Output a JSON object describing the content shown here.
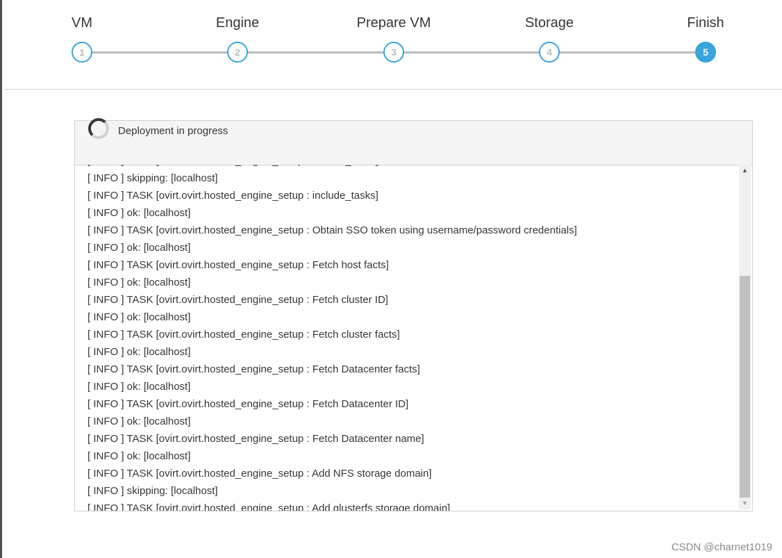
{
  "wizard": {
    "steps": [
      {
        "label": "VM",
        "number": "1",
        "active": false
      },
      {
        "label": "Engine",
        "number": "2",
        "active": false
      },
      {
        "label": "Prepare VM",
        "number": "3",
        "active": false
      },
      {
        "label": "Storage",
        "number": "4",
        "active": false
      },
      {
        "label": "Finish",
        "number": "5",
        "active": true
      }
    ]
  },
  "deployment": {
    "title": "Deployment in progress",
    "log_lines": [
      "[ INFO ] TASK [ovirt.ovirt.hosted_engine_setup : include_tasks]",
      "[ INFO ] skipping: [localhost]",
      "[ INFO ] TASK [ovirt.ovirt.hosted_engine_setup : include_tasks]",
      "[ INFO ] ok: [localhost]",
      "[ INFO ] TASK [ovirt.ovirt.hosted_engine_setup : Obtain SSO token using username/password credentials]",
      "[ INFO ] ok: [localhost]",
      "[ INFO ] TASK [ovirt.ovirt.hosted_engine_setup : Fetch host facts]",
      "[ INFO ] ok: [localhost]",
      "[ INFO ] TASK [ovirt.ovirt.hosted_engine_setup : Fetch cluster ID]",
      "[ INFO ] ok: [localhost]",
      "[ INFO ] TASK [ovirt.ovirt.hosted_engine_setup : Fetch cluster facts]",
      "[ INFO ] ok: [localhost]",
      "[ INFO ] TASK [ovirt.ovirt.hosted_engine_setup : Fetch Datacenter facts]",
      "[ INFO ] ok: [localhost]",
      "[ INFO ] TASK [ovirt.ovirt.hosted_engine_setup : Fetch Datacenter ID]",
      "[ INFO ] ok: [localhost]",
      "[ INFO ] TASK [ovirt.ovirt.hosted_engine_setup : Fetch Datacenter name]",
      "[ INFO ] ok: [localhost]",
      "[ INFO ] TASK [ovirt.ovirt.hosted_engine_setup : Add NFS storage domain]",
      "[ INFO ] skipping: [localhost]",
      "[ INFO ] TASK [ovirt.ovirt.hosted_engine_setup : Add glusterfs storage domain]"
    ],
    "scroll_position": 1.0
  },
  "watermark": "CSDN @charnet1019",
  "colors": {
    "accent": "#39a5dc",
    "step_line": "#bbbbbb",
    "text": "#363636",
    "panel_header": "#f5f5f5"
  }
}
